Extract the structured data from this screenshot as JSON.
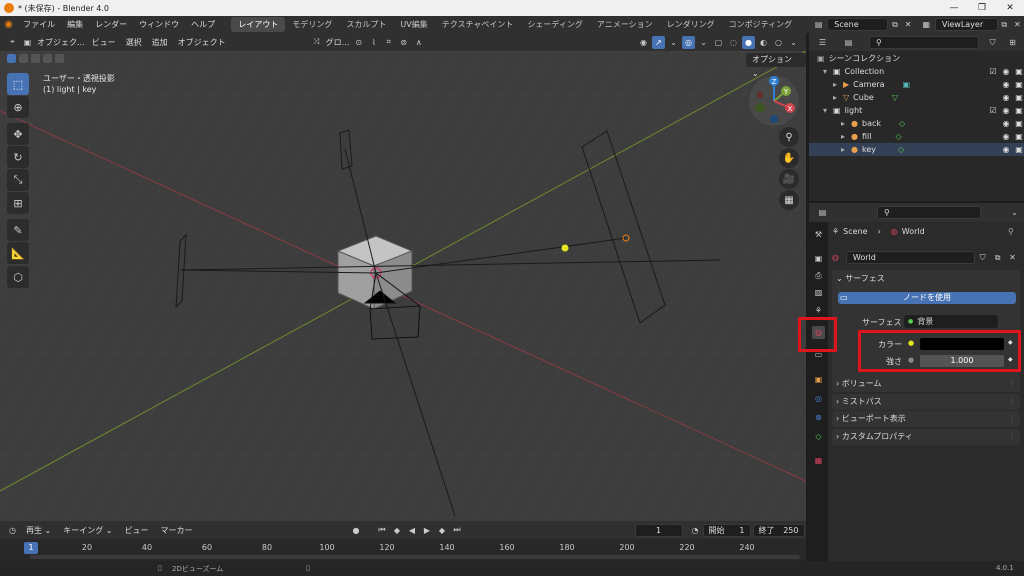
{
  "window": {
    "title": "* (未保存) - Blender 4.0",
    "minimize": "—",
    "maximize": "❐",
    "close": "✕"
  },
  "menu": [
    "ファイル",
    "編集",
    "レンダー",
    "ウィンドウ",
    "ヘルプ"
  ],
  "workspaces": [
    "レイアウト",
    "モデリング",
    "スカルプト",
    "UV編集",
    "テクスチャペイント",
    "シェーディング",
    "アニメーション",
    "レンダリング",
    "コンポジティング"
  ],
  "scene_field": "Scene",
  "viewlayer_field": "ViewLayer",
  "viewport": {
    "mode": "オブジェク...",
    "menus": [
      "ビュー",
      "選択",
      "追加",
      "オブジェクト"
    ],
    "transform": "グロ...",
    "options": "オプション",
    "overlay_title": "ユーザー・透視投影",
    "overlay_sub": "(1) light | key",
    "gizmo": {
      "z": "Z",
      "y": "Y",
      "x": "X"
    }
  },
  "outliner": {
    "scene_collection": "シーンコレクション",
    "rows": [
      {
        "label": "Collection",
        "kind": "collection"
      },
      {
        "label": "Camera",
        "kind": "camera"
      },
      {
        "label": "Cube",
        "kind": "mesh"
      },
      {
        "label": "light",
        "kind": "collection"
      },
      {
        "label": "back",
        "kind": "light"
      },
      {
        "label": "fill",
        "kind": "light"
      },
      {
        "label": "key",
        "kind": "light"
      }
    ]
  },
  "properties": {
    "breadcrumb_scene": "Scene",
    "breadcrumb_world": "World",
    "world_name": "World",
    "surface_panel": "サーフェス",
    "use_nodes": "ノードを使用",
    "surface_label": "サーフェス",
    "surface_value": "背景",
    "color_label": "カラー",
    "strength_label": "強さ",
    "strength_value": "1.000",
    "collapsed_panels": [
      "ボリューム",
      "ミストパス",
      "ビューポート表示",
      "カスタムプロパティ"
    ],
    "highlight_color": "#e0141c"
  },
  "timeline": {
    "playback": "再生",
    "keying": "キーイング",
    "view": "ビュー",
    "marker": "マーカー",
    "current_frame": "1",
    "start_label": "開始",
    "start_value": "1",
    "end_label": "終了",
    "end_value": "250",
    "frames": [
      "1",
      "20",
      "40",
      "60",
      "80",
      "100",
      "120",
      "140",
      "160",
      "180",
      "200",
      "220",
      "240"
    ]
  },
  "status": {
    "hint": "2Dビューズーム",
    "version": "4.0.1"
  }
}
